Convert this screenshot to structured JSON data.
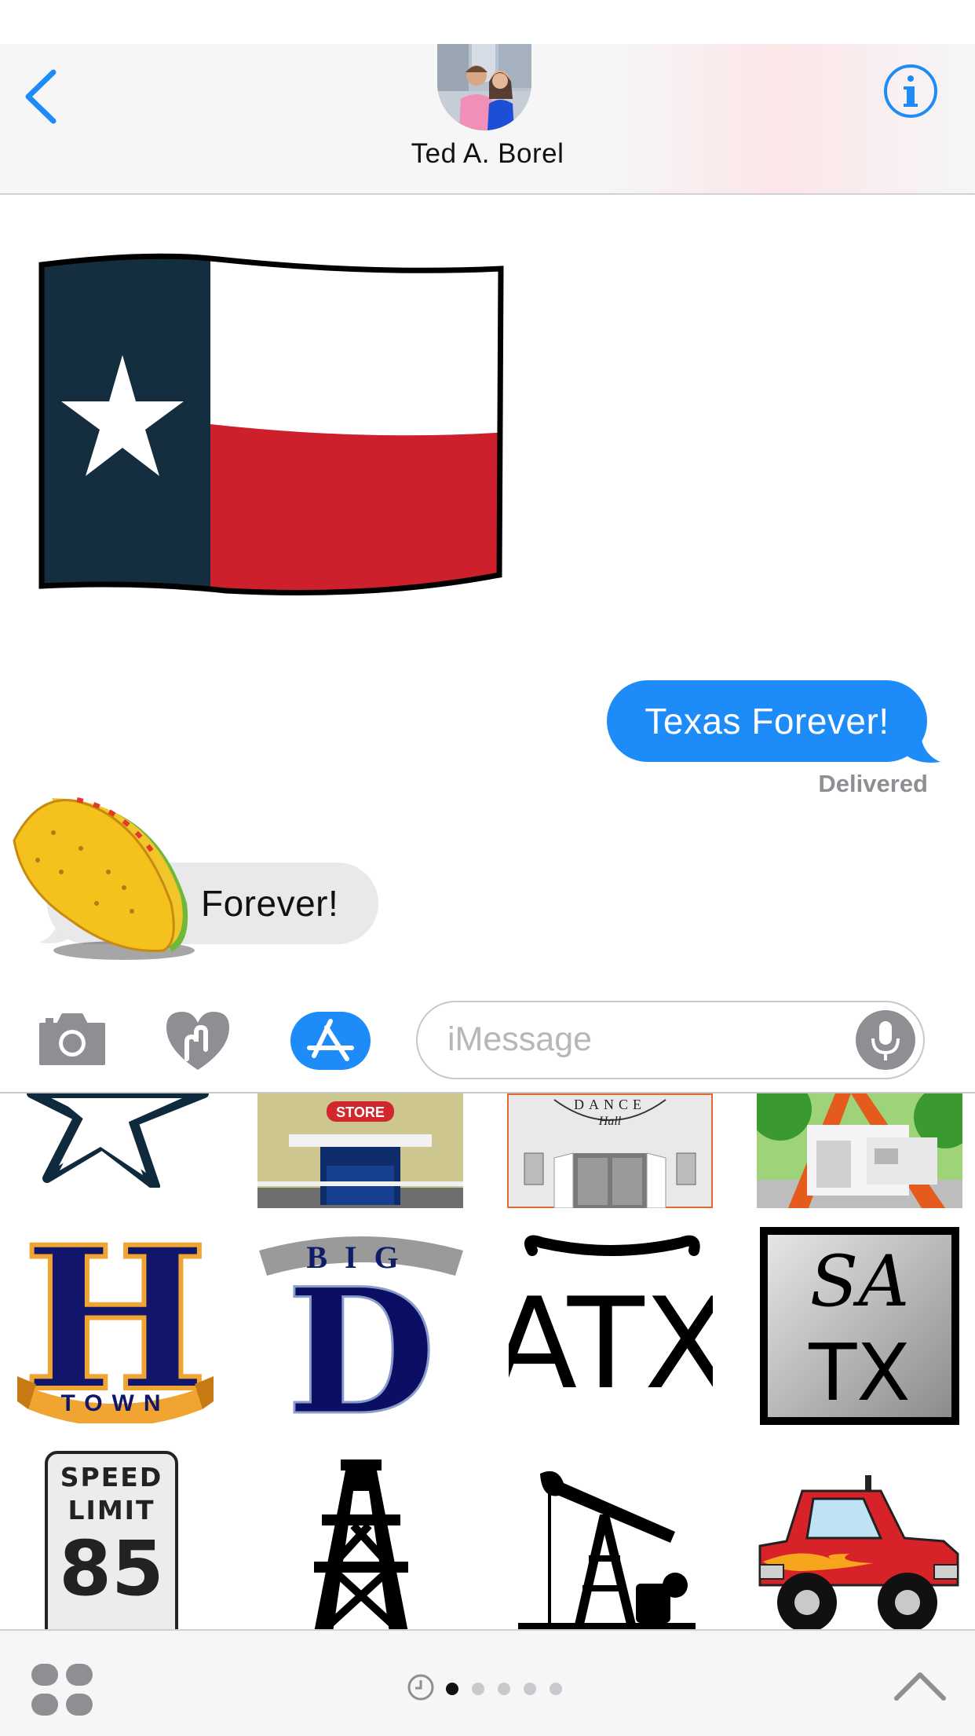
{
  "header": {
    "contact_name": "Ted A. Borel",
    "back_icon": "chevron-left-icon",
    "info_icon": "info-icon",
    "accent_color": "#1e8cf8"
  },
  "conversation": {
    "messages": [
      {
        "direction": "incoming",
        "type": "sticker",
        "sticker": "texas-flag-sticker"
      },
      {
        "direction": "outgoing",
        "type": "text",
        "text": "Texas Forever!",
        "bubble_color": "#1e8cf8"
      },
      {
        "direction": "incoming",
        "type": "text",
        "text": "Forever!",
        "bubble_color": "#e9e9eb",
        "overlay_sticker": "taco-sticker"
      }
    ],
    "status": "Delivered"
  },
  "input_bar": {
    "camera_icon": "camera-icon",
    "digital_touch_icon": "digital-touch-heart-icon",
    "app_store_icon": "app-store-icon",
    "placeholder": "iMessage",
    "mic_icon": "microphone-icon"
  },
  "sticker_drawer": {
    "stickers": [
      {
        "name": "star-sticker",
        "label": ""
      },
      {
        "name": "store-sticker",
        "label": "STORE"
      },
      {
        "name": "dance-hall-sticker",
        "label": "DANCE Hall"
      },
      {
        "name": "building-sticker",
        "label": ""
      },
      {
        "name": "h-town-sticker",
        "label": "H",
        "banner": "TOWN"
      },
      {
        "name": "big-d-sticker",
        "label": "D",
        "banner": "BIG"
      },
      {
        "name": "atx-sticker",
        "label": "ATX"
      },
      {
        "name": "satx-sticker",
        "line1": "SA",
        "line2": "TX"
      },
      {
        "name": "speed-limit-sticker",
        "line1": "SPEED",
        "line2": "LIMIT",
        "value": "85"
      },
      {
        "name": "oil-derrick-sticker",
        "label": ""
      },
      {
        "name": "pumpjack-sticker",
        "label": ""
      },
      {
        "name": "monster-truck-sticker",
        "label": ""
      }
    ]
  },
  "bottom_bar": {
    "apps_icon": "apps-grid-icon",
    "recents_icon": "clock-icon",
    "page_count": 5,
    "active_page": 1,
    "collapse_icon": "chevron-up-icon"
  }
}
